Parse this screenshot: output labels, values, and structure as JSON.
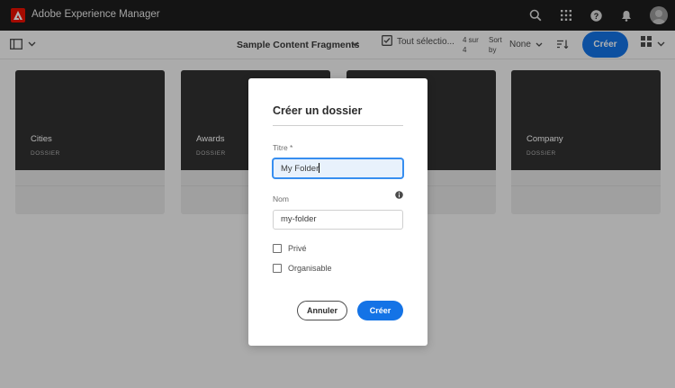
{
  "header": {
    "app_title": "Adobe Experience Manager",
    "icons": [
      "adobe-logo",
      "search-icon",
      "apps-grid-icon",
      "help-icon",
      "bell-icon",
      "user-avatar"
    ]
  },
  "actionbar": {
    "breadcrumb_title": "Sample Content Fragments",
    "select_all_label": "Tout sélectio...",
    "count_line1": "4 sur",
    "count_line2": "4",
    "sort_line1": "Sort",
    "sort_line2": "by",
    "sort_value": "None",
    "create_label": "Créer"
  },
  "cards": [
    {
      "title": "Cities",
      "type": "DOSSIER"
    },
    {
      "title": "Awards",
      "type": "DOSSIER"
    },
    {
      "title": "",
      "type": ""
    },
    {
      "title": "Company",
      "type": "DOSSIER"
    }
  ],
  "dialog": {
    "title": "Créer un dossier",
    "title_field_label": "Titre *",
    "title_field_value": "My Folder",
    "name_field_label": "Nom",
    "name_field_value": "my-folder",
    "private_label": "Privé",
    "orderable_label": "Organisable",
    "cancel_label": "Annuler",
    "create_label": "Créer"
  },
  "colors": {
    "accent": "#1473e6",
    "header_bg": "#1e1e1e",
    "adobe_red": "#eb1000",
    "card_dark": "#323232"
  }
}
